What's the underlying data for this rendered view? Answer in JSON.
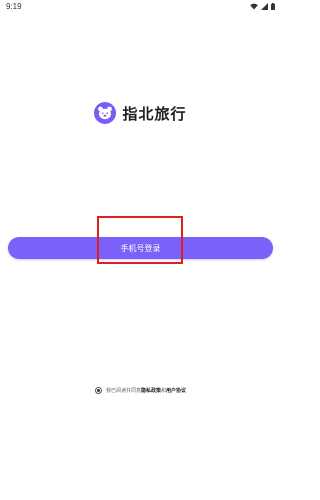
{
  "status_bar": {
    "time": "9:19",
    "icons": [
      "wifi-icon",
      "signal-icon",
      "battery-icon"
    ]
  },
  "app": {
    "logo_icon": "bear-logo-icon",
    "name": "指北旅行",
    "brand_color": "#7b61f8"
  },
  "login": {
    "button_label": "手机号登录"
  },
  "annotation": {
    "highlight_color": "#e0201c"
  },
  "agreement": {
    "checked": true,
    "prefix": "我已阅读并同意",
    "privacy_link": "隐私政策",
    "and": "和",
    "user_agreement_link": "用户协议"
  }
}
